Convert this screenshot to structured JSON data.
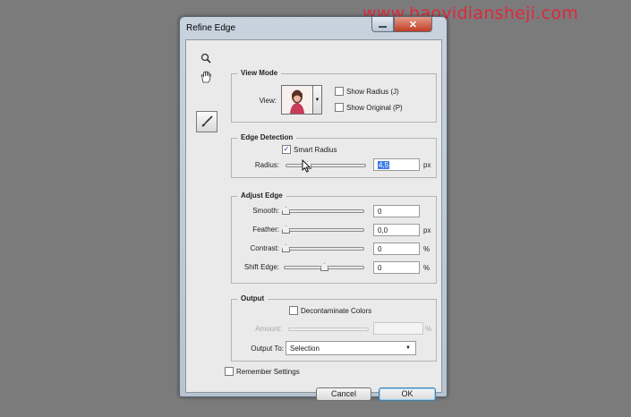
{
  "watermark": "www.haoyidiansheji.com",
  "window": {
    "title": "Refine Edge",
    "close_glyph": "✕"
  },
  "tools": {
    "zoom_icon": "zoom-icon",
    "hand_icon": "hand-icon",
    "brush_icon": "refine-radius-brush-icon"
  },
  "view_mode": {
    "heading": "View Mode",
    "view_label": "View:",
    "show_radius": {
      "label": "Show Radius (J)",
      "checked": false
    },
    "show_original": {
      "label": "Show Original (P)",
      "checked": false
    }
  },
  "edge_detection": {
    "heading": "Edge Detection",
    "smart_radius": {
      "label": "Smart Radius",
      "checked": true
    },
    "radius": {
      "label": "Radius:",
      "value": "4,5",
      "unit": "px",
      "slider_fraction": 0.26
    }
  },
  "adjust_edge": {
    "heading": "Adjust Edge",
    "rows": [
      {
        "label": "Smooth:",
        "value": "0",
        "unit": "",
        "slider_fraction": 0.0
      },
      {
        "label": "Feather:",
        "value": "0,0",
        "unit": "px",
        "slider_fraction": 0.0
      },
      {
        "label": "Contrast:",
        "value": "0",
        "unit": "%",
        "slider_fraction": 0.0
      },
      {
        "label": "Shift Edge:",
        "value": "0",
        "unit": "%",
        "slider_fraction": 0.5
      }
    ]
  },
  "output": {
    "heading": "Output",
    "decontaminate": {
      "label": "Decontaminate Colors",
      "checked": false
    },
    "amount": {
      "label": "Amount:",
      "value": "",
      "unit": "%"
    },
    "output_to": {
      "label": "Output To:",
      "selected": "Selection"
    }
  },
  "remember_settings": {
    "label": "Remember Settings",
    "checked": false
  },
  "buttons": {
    "cancel": "Cancel",
    "ok": "OK"
  },
  "colors": {
    "accent": "#3f7ce6",
    "watermark": "#e0283c",
    "background": "#7b7b7b"
  }
}
